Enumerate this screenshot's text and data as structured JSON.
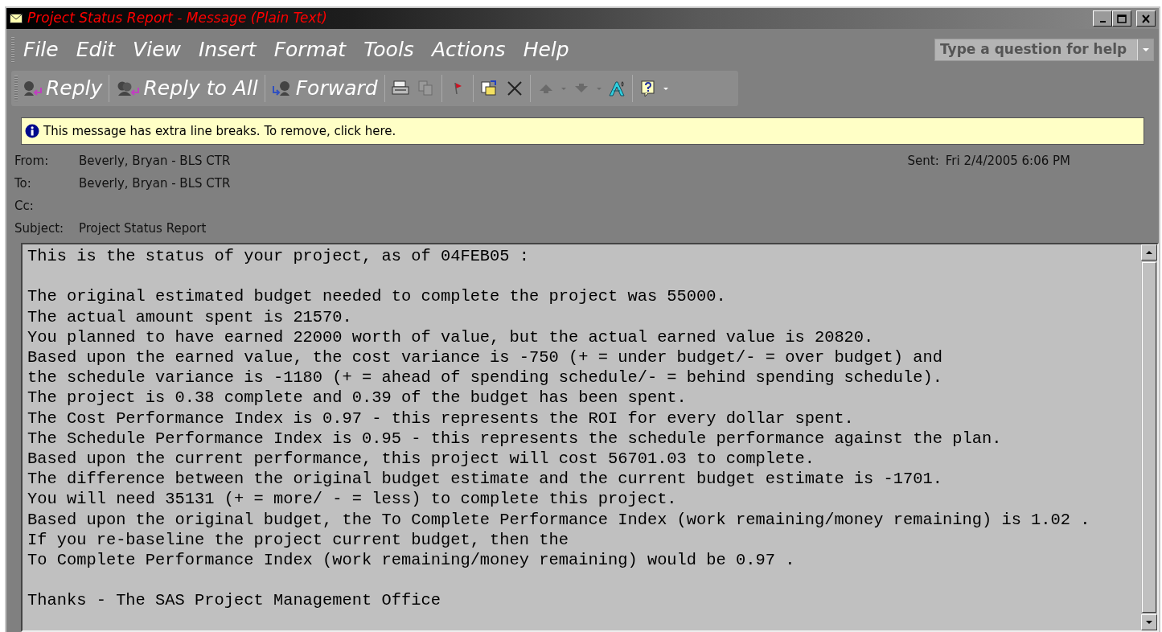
{
  "window": {
    "title": "Project Status Report - Message (Plain Text)"
  },
  "menu": [
    "File",
    "Edit",
    "View",
    "Insert",
    "Format",
    "Tools",
    "Actions",
    "Help"
  ],
  "help_box": {
    "placeholder": "Type a question for help"
  },
  "toolbar": [
    {
      "label": "Reply"
    },
    {
      "label": "Reply to All"
    },
    {
      "label": "Forward"
    }
  ],
  "infobar": "This message has extra line breaks. To remove, click here.",
  "headers": [
    {
      "label": "From:",
      "value": "Beverly, Bryan - BLS CTR"
    },
    {
      "label": "To:",
      "value": "Beverly, Bryan - BLS CTR"
    },
    {
      "label": "Cc:"
    },
    {
      "label": "Subject:",
      "value": "Project Status Report"
    }
  ],
  "sent": {
    "label": "Sent:",
    "value": "Fri 2/4/2005 6:06 PM"
  },
  "body": [
    [
      "This is the status of your project, as of 04FEB05 :"
    ],
    [
      "The original estimated budget needed to complete the project was 55000.",
      "The actual amount spent is 21570.",
      "You planned to have earned 22000 worth of value, but the actual earned value is 20820.",
      "Based upon the earned value, the cost variance is -750 (+ = under budget/- = over budget) and",
      "the schedule variance is -1180 (+ = ahead of spending schedule/- = behind spending schedule).",
      "The project is 0.38 complete and 0.39 of the budget has been spent.",
      "The Cost Performance Index is 0.97 - this represents the ROI for every dollar spent.",
      "The Schedule Performance Index is 0.95 - this represents the schedule performance against the plan.",
      "Based upon the current performance, this project will cost 56701.03 to complete.",
      "The difference between the original budget estimate and the current budget estimate is -1701.",
      "You will need 35131 (+ = more/ - = less) to complete this project.",
      "Based upon the original budget, the To Complete Performance Index (work remaining/money remaining) is 1.02 .",
      "If you re-baseline the project current budget, then the",
      "To Complete Performance Index (work remaining/money remaining) would be 0.97 ."
    ],
    [
      "Thanks - The SAS Project Management Office"
    ]
  ]
}
